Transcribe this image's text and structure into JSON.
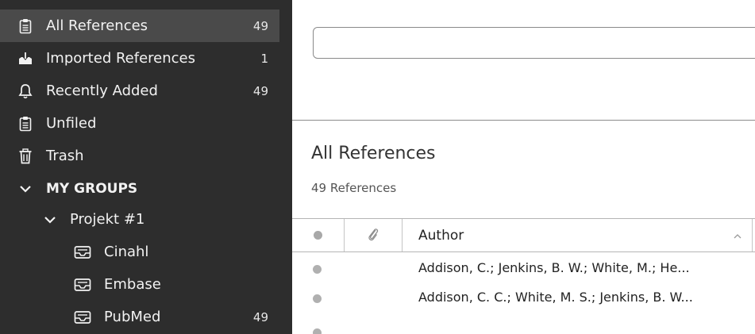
{
  "sidebar": {
    "items": [
      {
        "label": "All References",
        "count": "49",
        "icon": "clipboard-icon"
      },
      {
        "label": "Imported References",
        "count": "1",
        "icon": "import-icon"
      },
      {
        "label": "Recently Added",
        "count": "49",
        "icon": "bell-icon"
      },
      {
        "label": "Unfiled",
        "count": "",
        "icon": "clipboard-lines-icon"
      },
      {
        "label": "Trash",
        "count": "",
        "icon": "trash-icon"
      }
    ],
    "groups_header": "MY GROUPS",
    "group_set": "Projekt #1",
    "groups": [
      {
        "label": "Cinahl",
        "count": ""
      },
      {
        "label": "Embase",
        "count": ""
      },
      {
        "label": "PubMed",
        "count": "49"
      }
    ]
  },
  "main": {
    "search": {
      "value": "",
      "placeholder": ""
    },
    "title": "All References",
    "count": "49 References",
    "columns": {
      "author": "Author"
    },
    "rows": [
      {
        "author": "Addison, C.; Jenkins, B. W.; White, M.; He..."
      },
      {
        "author": "Addison, C. C.; White, M. S.; Jenkins, B. W..."
      }
    ]
  },
  "colors": {
    "sidebar_bg": "#2d2d2d",
    "selected_bg": "#4a4a4a",
    "read_dot": "#b0b0b0"
  }
}
